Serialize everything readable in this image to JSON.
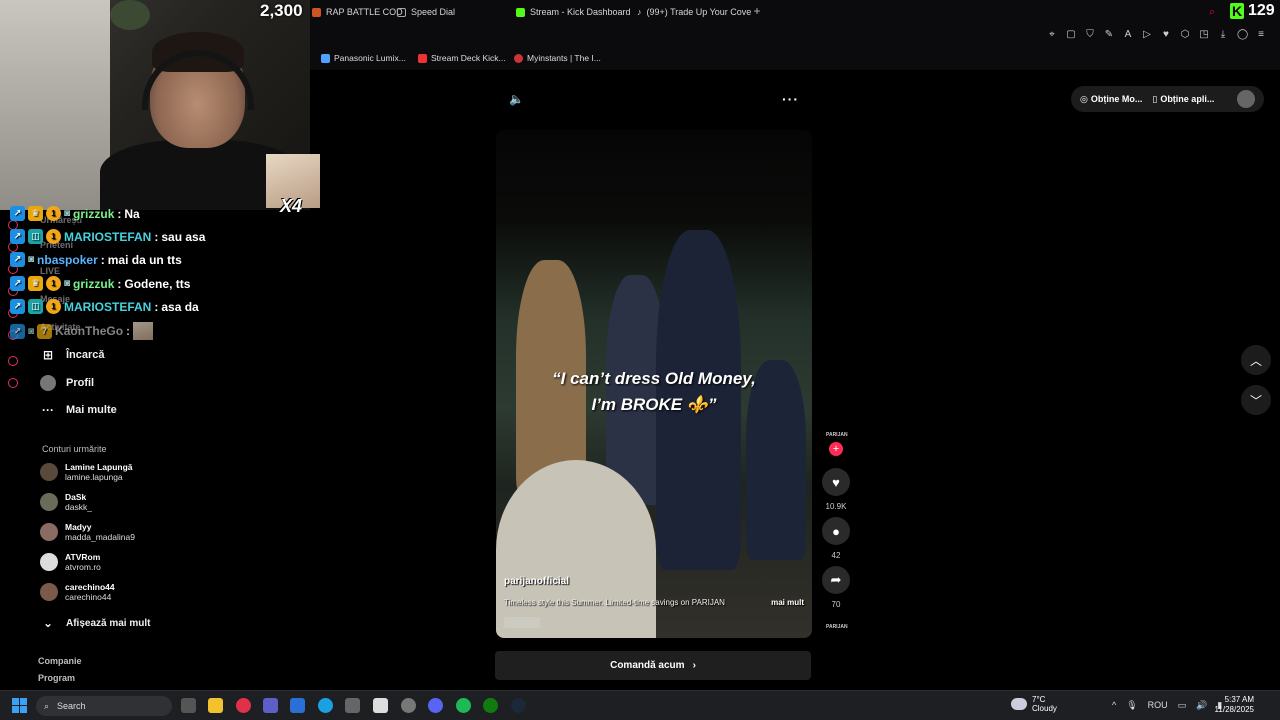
{
  "browser": {
    "tabs": [
      {
        "label": "RAP BATTLE COD",
        "color": "#c52"
      },
      {
        "label": "Speed Dial",
        "color": "#aaa"
      },
      {
        "label": "Stream - Kick Dashboard",
        "color": "#53fc18"
      },
      {
        "label": "(99+) Trade Up Your Cove",
        "color": "#fff"
      }
    ],
    "bookmarks": [
      {
        "label": "Panasonic Lumix...",
        "color": "#4da3ff"
      },
      {
        "label": "Stream Deck Kick...",
        "color": "#e33"
      },
      {
        "label": "Myinstants | The I...",
        "color": "#c33"
      }
    ]
  },
  "stream": {
    "viewers": "2,300",
    "kick_count": "129",
    "emote_multiplier": "X4"
  },
  "chat": [
    {
      "user": "grizzuk",
      "text": "Na",
      "color": "green"
    },
    {
      "user": "MARIOSTEFAN",
      "text": "sau asa",
      "color": "teal"
    },
    {
      "user": "nbaspoker",
      "text": "mai da un tts",
      "color": "blue"
    },
    {
      "user": "grizzuk",
      "text": "Godene, tts",
      "color": "green"
    },
    {
      "user": "MARIOSTEFAN",
      "text": "asa da",
      "color": "teal"
    },
    {
      "user": "KaonTheGo",
      "text": "",
      "color": "gray"
    }
  ],
  "sidebar": {
    "hidden_items": [
      "Urmărești",
      "Prieteni",
      "LIVE",
      "Mesaje",
      "Activitate"
    ],
    "items": [
      {
        "label": "Încarcă",
        "icon": "upload-icon"
      },
      {
        "label": "Profil",
        "icon": "profile-icon"
      },
      {
        "label": "Mai multe",
        "icon": "more-icon"
      }
    ],
    "following_title": "Conturi urmărite",
    "following": [
      {
        "name": "Lamine Lapungă",
        "handle": "lamine.lapunga"
      },
      {
        "name": "DaSk",
        "handle": "daskk_"
      },
      {
        "name": "Madyy",
        "handle": "madda_madalina9"
      },
      {
        "name": "ATVRom",
        "handle": "atvrom.ro"
      },
      {
        "name": "carechino44",
        "handle": "carechino44"
      }
    ],
    "show_more": "Afișează mai mult",
    "footer": [
      "Companie",
      "Program"
    ]
  },
  "video": {
    "caption_line1": "“I can’t dress Old Money,",
    "caption_line2": "I’m BROKE ⚜️”",
    "author": "parijanofficial",
    "description": "Timeless style this Summer. Limited-time savings on PARIJAN",
    "more": "mai mult",
    "ad_label": "Reclamă",
    "brand_small": "PARIJAN",
    "likes": "10.9K",
    "comments": "42",
    "shares": "70",
    "order_button": "Comandă acum"
  },
  "top_right": {
    "get_mode": "Obține Mo...",
    "get_app": "Obține apli..."
  },
  "taskbar": {
    "search": "Search",
    "weather_temp": "7°C",
    "weather_desc": "Cloudy",
    "lang": "ROU",
    "time": "5:37 AM",
    "date": "11/28/2025"
  }
}
